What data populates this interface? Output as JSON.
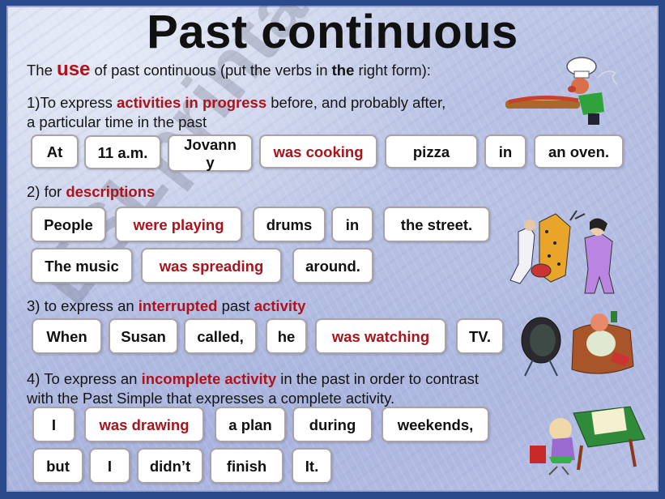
{
  "title": "Past continuous",
  "watermark": "ESLprintables.com",
  "intro": {
    "prefix": "The ",
    "highlight": "use",
    "middle": " of past continuous (put the verbs in ",
    "bold": "the",
    "suffix": " right form):"
  },
  "sections": [
    {
      "heading_lines": [
        {
          "prefix": "1)To express ",
          "highlight": "activities in progress",
          "suffix": " before, and probably after,"
        },
        {
          "prefix": "a particular time in the past",
          "highlight": "",
          "suffix": ""
        }
      ],
      "rows": [
        [
          {
            "text": "At",
            "verb": false
          },
          {
            "text": "11 a.m.",
            "verb": false
          },
          {
            "text": "Jovanny",
            "line1": "Jovann",
            "line2": "y",
            "verb": false
          },
          {
            "text": "was cooking",
            "verb": true
          },
          {
            "text": "pizza",
            "verb": false
          },
          {
            "text": "in",
            "verb": false
          },
          {
            "text": "an oven.",
            "verb": false
          }
        ]
      ],
      "illustration": "chef-with-pizza-icon"
    },
    {
      "heading_lines": [
        {
          "prefix": "2) for ",
          "highlight": "descriptions",
          "suffix": ""
        }
      ],
      "rows": [
        [
          {
            "text": "People",
            "verb": false
          },
          {
            "text": "were playing",
            "verb": true
          },
          {
            "text": "drums",
            "verb": false
          },
          {
            "text": "in",
            "verb": false
          },
          {
            "text": "the street.",
            "verb": false
          }
        ],
        [
          {
            "text": "The music",
            "verb": false
          },
          {
            "text": "was spreading",
            "verb": true
          },
          {
            "text": "around.",
            "verb": false
          }
        ]
      ],
      "illustration": "street-musicians-icon"
    },
    {
      "heading_lines": [
        {
          "prefix": "3) to express an ",
          "highlight": "interrupted",
          "middle": " past ",
          "highlight2": "activity",
          "suffix": ""
        }
      ],
      "rows": [
        [
          {
            "text": "When",
            "verb": false
          },
          {
            "text": "Susan",
            "verb": false
          },
          {
            "text": "called,",
            "verb": false
          },
          {
            "text": "he",
            "verb": false
          },
          {
            "text": "was watching",
            "verb": true
          },
          {
            "text": "TV.",
            "verb": false
          }
        ]
      ],
      "illustration": "man-watching-tv-icon"
    },
    {
      "heading_lines": [
        {
          "prefix": "4) To express an ",
          "highlight": "incomplete activity",
          "suffix": " in the past in order to contrast"
        },
        {
          "prefix": "with the Past Simple that expresses a complete activity.",
          "highlight": "",
          "suffix": ""
        }
      ],
      "rows": [
        [
          {
            "text": "I",
            "verb": false
          },
          {
            "text": "was drawing",
            "verb": true
          },
          {
            "text": "a plan",
            "verb": false
          },
          {
            "text": "during",
            "verb": false
          },
          {
            "text": "weekends,",
            "verb": false
          }
        ],
        [
          {
            "text": "but",
            "verb": false
          },
          {
            "text": "I",
            "verb": false
          },
          {
            "text": "didn’t",
            "verb": false
          },
          {
            "text": "finish",
            "verb": false
          },
          {
            "text": "It.",
            "verb": false
          }
        ]
      ],
      "illustration": "person-drawing-at-desk-icon"
    }
  ],
  "colors": {
    "highlight": "#b0121b",
    "frame": "#2b4a8c",
    "chip_border": "#a9a3a8"
  }
}
